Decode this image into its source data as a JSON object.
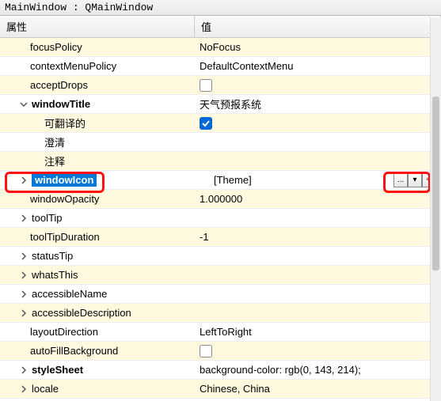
{
  "title": "MainWindow : QMainWindow",
  "columns": {
    "property": "属性",
    "value": "值"
  },
  "rows": [
    {
      "prop": "focusPolicy",
      "val": "NoFocus",
      "indent": 1,
      "alt": true
    },
    {
      "prop": "contextMenuPolicy",
      "val": "DefaultContextMenu",
      "indent": 1
    },
    {
      "prop": "acceptDrops",
      "val_type": "checkbox",
      "checked": false,
      "indent": 1,
      "alt": true
    },
    {
      "prop": "windowTitle",
      "val": "天气预报系统",
      "indent": 1,
      "expando": "open",
      "bold": true
    },
    {
      "prop": "可翻译的",
      "val_type": "checkbox",
      "checked": true,
      "indent": 2,
      "alt": true
    },
    {
      "prop": "澄清",
      "val": "",
      "indent": 2
    },
    {
      "prop": "注释",
      "val": "",
      "indent": 2,
      "alt": true
    },
    {
      "prop": "windowIcon",
      "val": "[Theme]",
      "indent": 1,
      "expando": "closed",
      "bold": true,
      "selected": true,
      "controls": true
    },
    {
      "prop": "windowOpacity",
      "val": "1.000000",
      "indent": 1,
      "alt": true
    },
    {
      "prop": "toolTip",
      "val": "",
      "indent": 1,
      "expando": "closed"
    },
    {
      "prop": "toolTipDuration",
      "val": "-1",
      "indent": 1,
      "alt": true
    },
    {
      "prop": "statusTip",
      "val": "",
      "indent": 1,
      "expando": "closed"
    },
    {
      "prop": "whatsThis",
      "val": "",
      "indent": 1,
      "expando": "closed",
      "alt": true
    },
    {
      "prop": "accessibleName",
      "val": "",
      "indent": 1,
      "expando": "closed"
    },
    {
      "prop": "accessibleDescription",
      "val": "",
      "indent": 1,
      "expando": "closed",
      "alt": true
    },
    {
      "prop": "layoutDirection",
      "val": "LeftToRight",
      "indent": 1
    },
    {
      "prop": "autoFillBackground",
      "val_type": "checkbox",
      "checked": false,
      "indent": 1,
      "alt": true
    },
    {
      "prop": "styleSheet",
      "val": "background-color: rgb(0, 143, 214);",
      "indent": 1,
      "expando": "closed",
      "bold": true
    },
    {
      "prop": "locale",
      "val": "Chinese, China",
      "indent": 1,
      "expando": "closed",
      "alt": true
    }
  ],
  "controls": {
    "browse": "...",
    "dropdown": "▾",
    "reset": "↶"
  }
}
